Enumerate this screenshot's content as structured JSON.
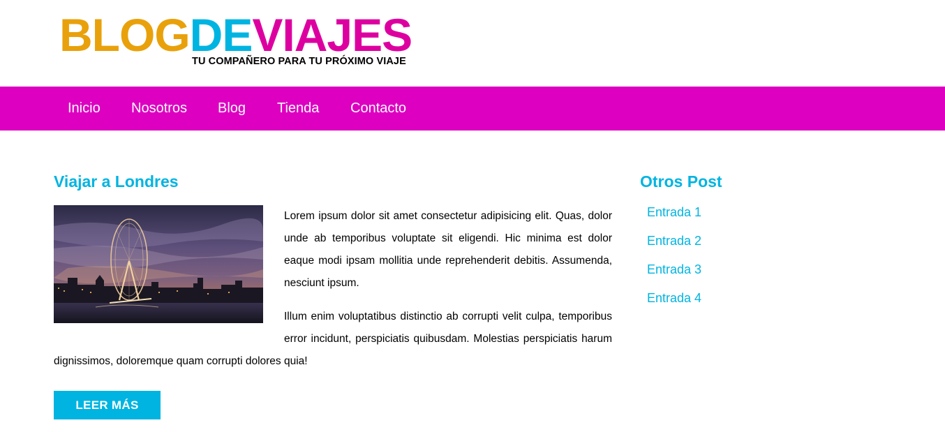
{
  "logo": {
    "parts": [
      {
        "text": "BLOG",
        "color": "#e9a10b"
      },
      {
        "text": "DE",
        "color": "#00b4e1"
      },
      {
        "text": "VIAJES",
        "color": "#dd00a0"
      }
    ],
    "tagline": "TU COMPAÑERO PARA TU PRÓXIMO VIAJE"
  },
  "colors": {
    "nav_background": "#dd00c1",
    "accent": "#00b4e1"
  },
  "nav": {
    "items": [
      {
        "label": "Inicio"
      },
      {
        "label": "Nosotros"
      },
      {
        "label": "Blog"
      },
      {
        "label": "Tienda"
      },
      {
        "label": "Contacto"
      }
    ]
  },
  "post": {
    "title": "Viajar a Londres",
    "image_alt": "london-eye-at-dusk-photo",
    "paragraphs": [
      "Lorem ipsum dolor sit amet consectetur adipisicing elit. Quas, dolor unde ab temporibus voluptate sit eligendi. Hic minima est dolor eaque modi ipsam mollitia unde reprehenderit debitis. Assumenda, nesciunt ipsum.",
      "Illum enim voluptatibus distinctio ab corrupti velit culpa, temporibus error incidunt, perspiciatis quibusdam. Molestias perspiciatis harum dignissimos, doloremque quam corrupti dolores quia!"
    ],
    "read_more_label": "LEER MÁS"
  },
  "sidebar": {
    "title": "Otros Post",
    "items": [
      {
        "label": "Entrada 1"
      },
      {
        "label": "Entrada 2"
      },
      {
        "label": "Entrada 3"
      },
      {
        "label": "Entrada 4"
      }
    ]
  }
}
